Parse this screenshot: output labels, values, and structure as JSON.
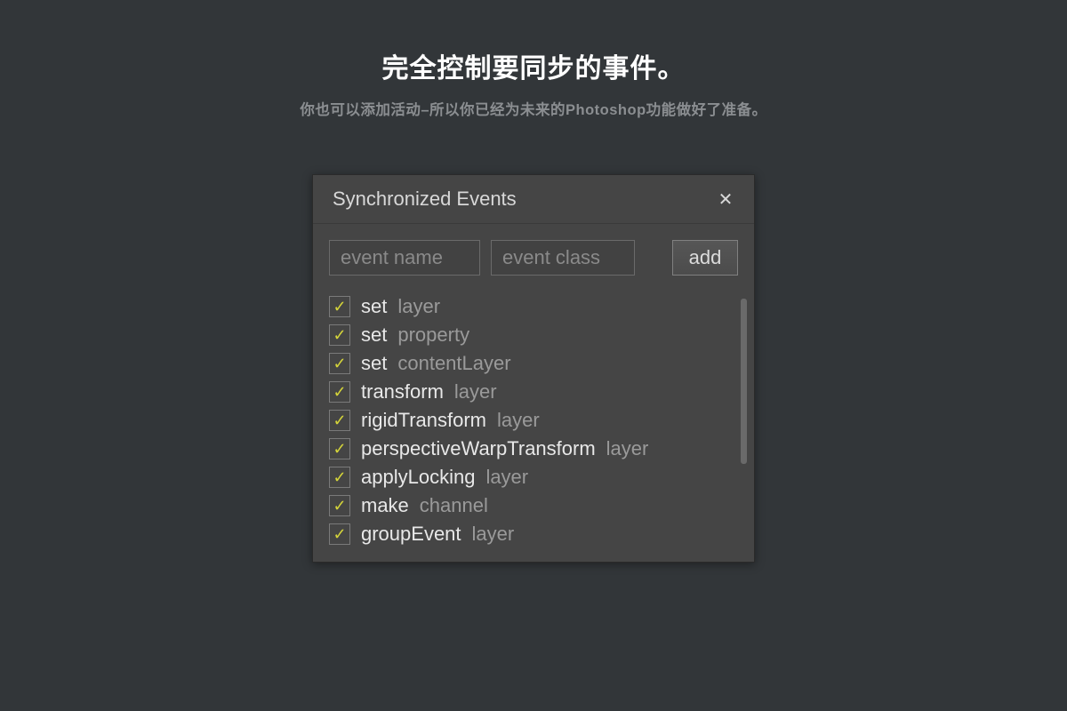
{
  "headline": "完全控制要同步的事件。",
  "subheadline": "你也可以添加活动–所以你已经为未来的Photoshop功能做好了准备。",
  "panel": {
    "title": "Synchronized Events",
    "close_icon": "✕",
    "inputs": {
      "name_placeholder": "event name",
      "class_placeholder": "event class",
      "add_label": "add"
    },
    "check_glyph": "✓",
    "events": [
      {
        "checked": true,
        "name": "set",
        "class": "layer"
      },
      {
        "checked": true,
        "name": "set",
        "class": "property"
      },
      {
        "checked": true,
        "name": "set",
        "class": "contentLayer"
      },
      {
        "checked": true,
        "name": "transform",
        "class": "layer"
      },
      {
        "checked": true,
        "name": "rigidTransform",
        "class": "layer"
      },
      {
        "checked": true,
        "name": "perspectiveWarpTransform",
        "class": "layer"
      },
      {
        "checked": true,
        "name": "applyLocking",
        "class": "layer"
      },
      {
        "checked": true,
        "name": "make",
        "class": "channel"
      },
      {
        "checked": true,
        "name": "groupEvent",
        "class": "layer"
      }
    ]
  }
}
